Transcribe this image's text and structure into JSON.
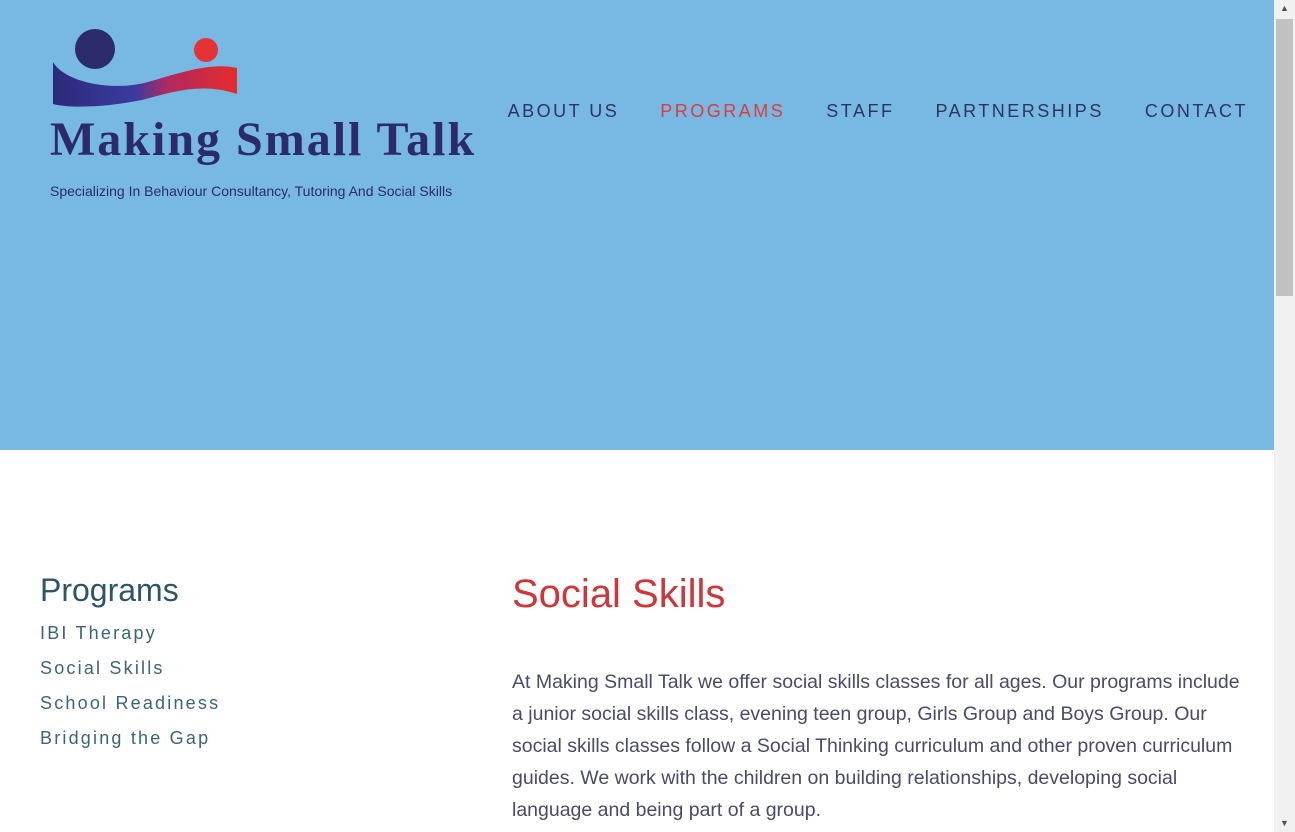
{
  "header": {
    "background_color": "#78b9e4",
    "logo": {
      "title": "Making Small Talk",
      "tagline": "Specializing In Behaviour Consultancy, Tutoring And Social Skills",
      "colors": {
        "navy": "#2b2a6b",
        "red": "#e53232"
      }
    },
    "nav": {
      "items": [
        {
          "label": "ABOUT US"
        },
        {
          "label": "PROGRAMS",
          "active": true
        },
        {
          "label": "STAFF"
        },
        {
          "label": "PARTNERSHIPS"
        },
        {
          "label": "CONTACT"
        }
      ],
      "active_color": "#e03a3a"
    }
  },
  "sidebar": {
    "title": "Programs",
    "links": [
      {
        "label": "IBI Therapy"
      },
      {
        "label": "Social Skills"
      },
      {
        "label": "School Readiness"
      },
      {
        "label": "Bridging the Gap"
      }
    ]
  },
  "main": {
    "title": "Social Skills",
    "title_color": "#d0353a",
    "body": "At Making Small Talk we offer social skills classes for all ages. Our programs include a junior social skills class, evening teen group, Girls Group and Boys Group. Our social skills classes follow a Social Thinking curriculum and other proven curriculum guides.  We work with the children on building relationships, developing social language and being part of a group."
  },
  "scrollbar": {
    "up_icon": "scroll-up-arrow-icon",
    "down_icon": "scroll-down-arrow-icon"
  }
}
